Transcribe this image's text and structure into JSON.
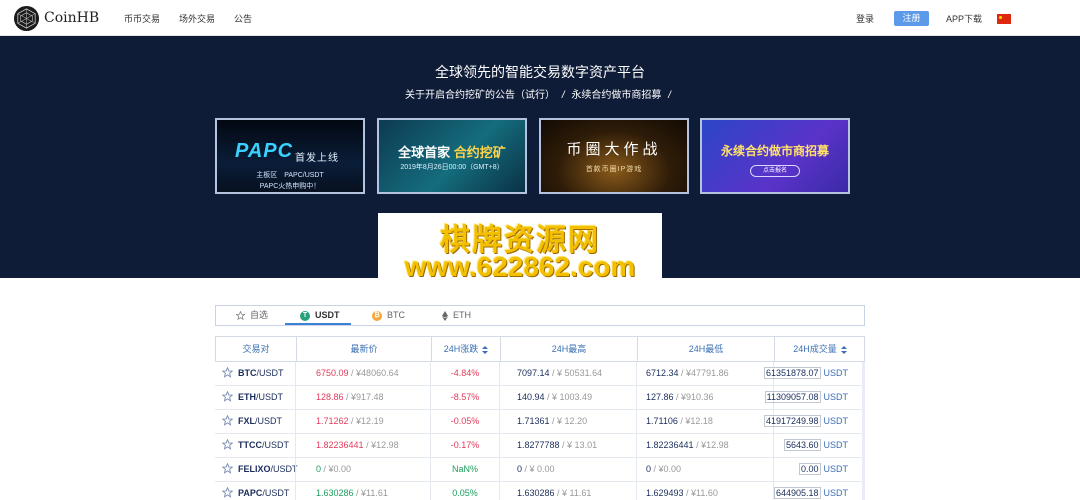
{
  "brand": {
    "name": "CoinHB"
  },
  "nav": {
    "links": [
      "币币交易",
      "场外交易",
      "公告"
    ],
    "login": "登录",
    "register": "注册",
    "app": "APP下载",
    "flag": "china-flag-icon"
  },
  "hero": {
    "title": "全球领先的智能交易数字资产平台",
    "announce1": "关于开启合约挖矿的公告（试行）",
    "sep": "/",
    "announce2": "永续合约做市商招募",
    "sep2": "/"
  },
  "banners": [
    {
      "title": "PAPC",
      "subtitle": "首发上线",
      "line1": "主板区　PAPC/USDT",
      "line2": "PAPC火热申购中！"
    },
    {
      "title_a": "全球首家 ",
      "title_b": "合约挖矿",
      "subtitle": "2019年8月26日00:00（GMT+8）"
    },
    {
      "title": "币圈大作战",
      "subtitle": "首款币圈IP游戏"
    },
    {
      "title": "永续合约做市商招募",
      "button": "点击报名"
    }
  ],
  "watermark": {
    "line1": "棋牌资源网",
    "line2": "www.622862.com"
  },
  "tabs": [
    {
      "label": "自选",
      "icon": "star-icon"
    },
    {
      "label": "USDT",
      "icon": "usdt-icon",
      "active": true
    },
    {
      "label": "BTC",
      "icon": "btc-icon"
    },
    {
      "label": "ETH",
      "icon": "eth-icon"
    }
  ],
  "table": {
    "headers": [
      "交易对",
      "最新价",
      "24H涨跌",
      "24H最高",
      "24H最低",
      "24H成交量"
    ],
    "rows": [
      {
        "base": "BTC",
        "quote": "/USDT",
        "price": "6750.09",
        "price_cny": " / ¥48060.64",
        "change": "-4.84%",
        "high": "7097.14",
        "high_cny": " / ¥ 50531.64",
        "low": "6712.34",
        "low_cny": " / ¥47791.86",
        "vol": "61351878.07",
        "vol_unit": "USDT",
        "dir": "up"
      },
      {
        "base": "ETH",
        "quote": "/USDT",
        "price": "128.86",
        "price_cny": " / ¥917.48",
        "change": "-8.57%",
        "high": "140.94",
        "high_cny": " / ¥ 1003.49",
        "low": "127.86",
        "low_cny": " / ¥910.36",
        "vol": "11309057.08",
        "vol_unit": "USDT",
        "dir": "up"
      },
      {
        "base": "FXL",
        "quote": "/USDT",
        "price": "1.71262",
        "price_cny": " / ¥12.19",
        "change": "-0.05%",
        "high": "1.71361",
        "high_cny": " / ¥ 12.20",
        "low": "1.71106",
        "low_cny": " / ¥12.18",
        "vol": "41917249.98",
        "vol_unit": "USDT",
        "dir": "up"
      },
      {
        "base": "TTCC",
        "quote": "/USDT",
        "price": "1.82236441",
        "price_cny": " / ¥12.98",
        "change": "-0.17%",
        "high": "1.8277788",
        "high_cny": " / ¥ 13.01",
        "low": "1.82236441",
        "low_cny": " / ¥12.98",
        "vol": "5643.60",
        "vol_unit": "USDT",
        "dir": "up"
      },
      {
        "base": "FELIXO",
        "quote": "/USDT",
        "price": "0",
        "price_cny": " / ¥0.00",
        "change": "NaN%",
        "high": "0",
        "high_cny": " / ¥ 0.00",
        "low": "0",
        "low_cny": " / ¥0.00",
        "vol": "0.00",
        "vol_unit": "USDT",
        "dir": "down"
      },
      {
        "base": "PAPC",
        "quote": "/USDT",
        "price": "1.630286",
        "price_cny": " / ¥11.61",
        "change": "0.05%",
        "high": "1.630286",
        "high_cny": " / ¥ 11.61",
        "low": "1.629493",
        "low_cny": " / ¥11.60",
        "vol": "644905.18",
        "vol_unit": "USDT",
        "dir": "down"
      }
    ]
  }
}
